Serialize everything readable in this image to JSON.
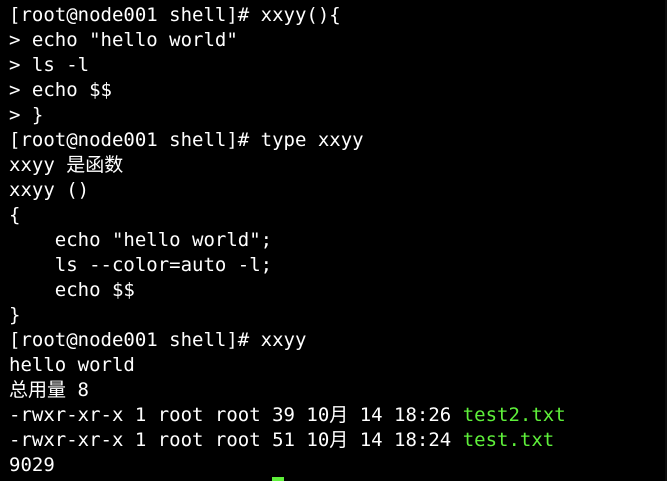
{
  "terminal": {
    "lines": [
      {
        "text": "[root@node001 shell]# xxyy(){"
      },
      {
        "text": "> echo \"hello world\""
      },
      {
        "text": "> ls -l"
      },
      {
        "text": "> echo $$"
      },
      {
        "text": "> }"
      },
      {
        "text": "[root@node001 shell]# type xxyy"
      },
      {
        "text": "xxyy 是函数"
      },
      {
        "text": "xxyy ()"
      },
      {
        "text": "{"
      },
      {
        "text": "    echo \"hello world\";"
      },
      {
        "text": "    ls --color=auto -l;"
      },
      {
        "text": "    echo $$"
      },
      {
        "text": "}"
      },
      {
        "text": "[root@node001 shell]# xxyy"
      },
      {
        "text": "hello world"
      },
      {
        "text": "总用量 8"
      },
      {
        "text": "-rwxr-xr-x 1 root root 39 10月 14 18:26 ",
        "file": "test2.txt"
      },
      {
        "text": "-rwxr-xr-x 1 root root 51 10月 14 18:24 ",
        "file": "test.txt"
      },
      {
        "text": "9029"
      }
    ],
    "colors": {
      "background": "#000000",
      "foreground": "#ffffff",
      "executable": "#5ef03a",
      "cursor": "#5ef03a"
    }
  }
}
